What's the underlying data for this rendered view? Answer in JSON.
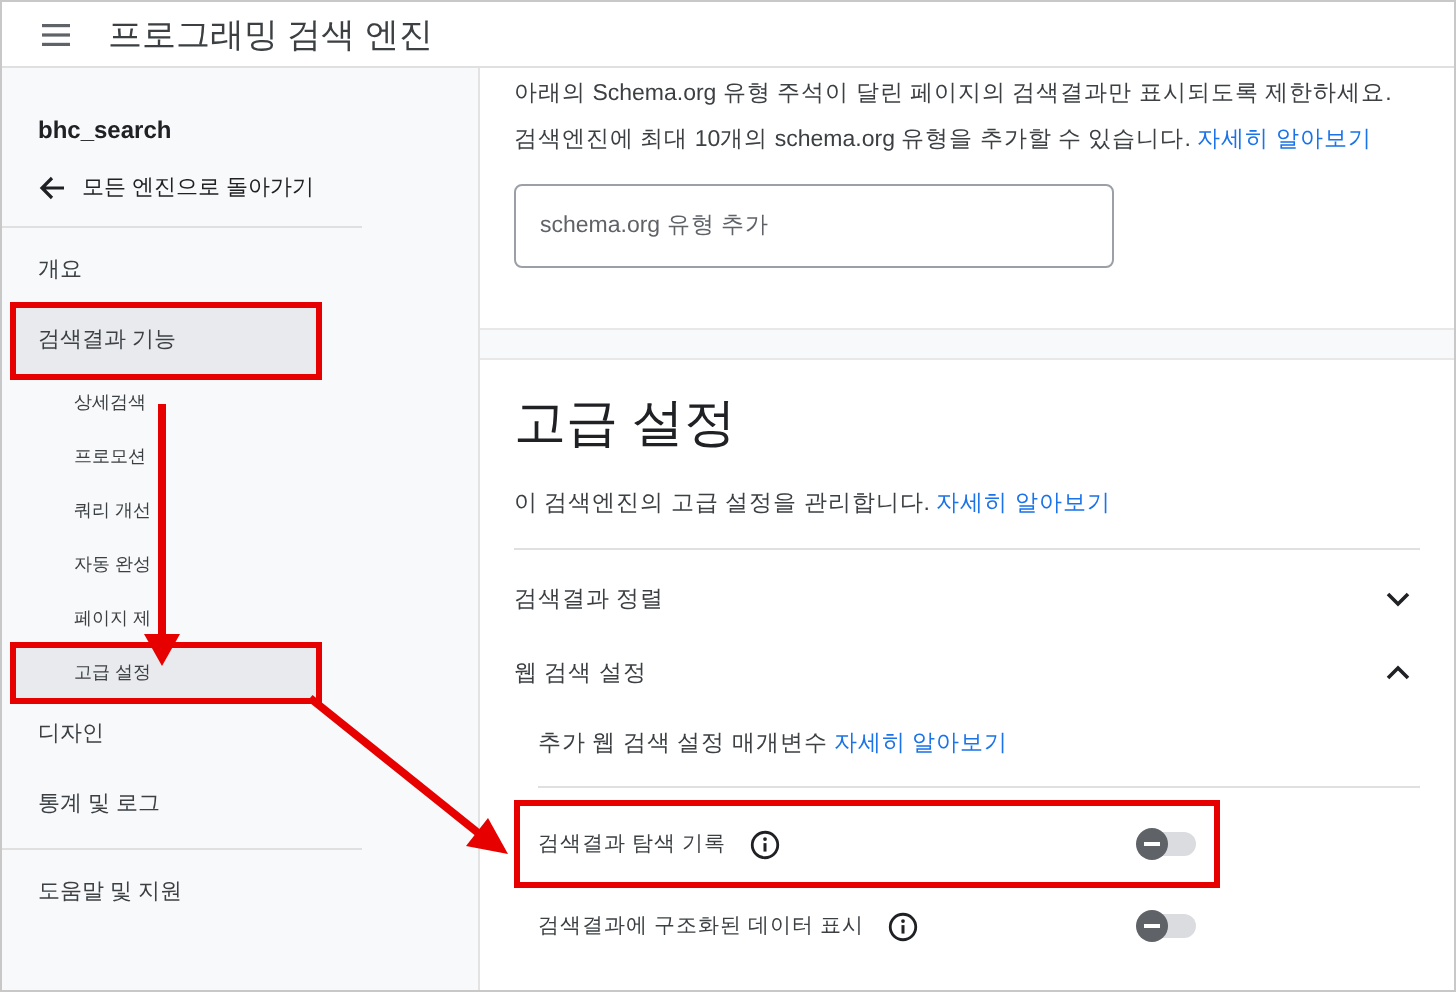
{
  "app_bar": {
    "title": "프로그래밍 검색 엔진"
  },
  "sidebar": {
    "engine_name": "bhc_search",
    "back_link": "모든 엔진으로 돌아가기",
    "items": [
      {
        "label": "개요",
        "selected": false,
        "highlighted": false
      },
      {
        "label": "검색결과 기능",
        "selected": true,
        "highlighted": true,
        "children": [
          {
            "label": "상세검색",
            "selected": false,
            "highlighted": false
          },
          {
            "label": "프로모션",
            "selected": false,
            "highlighted": false
          },
          {
            "label": "쿼리 개선",
            "selected": false,
            "highlighted": false
          },
          {
            "label": "자동 완성",
            "selected": false,
            "highlighted": false
          },
          {
            "label": "페이지 제",
            "selected": false,
            "highlighted": false
          },
          {
            "label": "고급 설정",
            "selected": true,
            "highlighted": true
          }
        ]
      },
      {
        "label": "디자인",
        "selected": false,
        "highlighted": false
      },
      {
        "label": "통계 및 로그",
        "selected": false,
        "highlighted": false
      }
    ],
    "footer_items": [
      {
        "label": "도움말 및 지원",
        "selected": false,
        "highlighted": false
      }
    ]
  },
  "schema_section": {
    "description_lines": [
      "아래의 Schema.org 유형 주석이 달린 페이지의 검색결과만 표시되도록 제한하세요.",
      "검색엔진에 최대 10개의 schema.org 유형을 추가할 수 있습니다."
    ],
    "link": "자세히 알아보기",
    "input": {
      "placeholder": "schema.org 유형 추가"
    }
  },
  "advanced": {
    "title": "고급 설정",
    "description": "이 검색엔진의 고급 설정을 관리합니다.",
    "link": "자세히 알아보기",
    "panels": [
      {
        "label": "검색결과 정렬",
        "expanded": false
      },
      {
        "label": "웹 검색 설정",
        "expanded": true
      }
    ],
    "web_settings": {
      "note": "추가 웹 검색 설정 매개변수",
      "link": "자세히 알아보기",
      "toggles": [
        {
          "label": "검색결과 탐색 기록",
          "on": false,
          "highlighted": true
        },
        {
          "label": "검색결과에 구조화된 데이터 표시",
          "on": false,
          "highlighted": false
        }
      ]
    }
  }
}
